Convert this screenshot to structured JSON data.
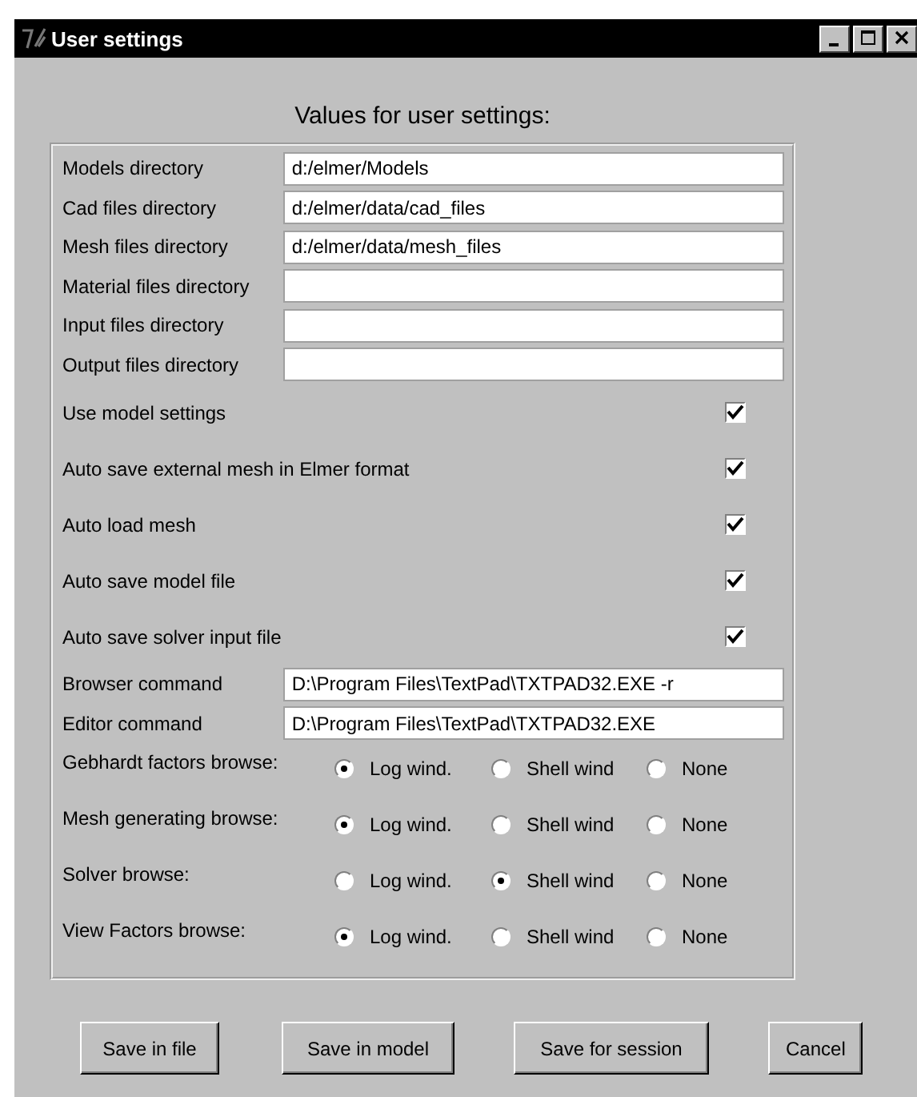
{
  "window": {
    "title": "User settings"
  },
  "heading": "Values for user settings:",
  "fields": [
    {
      "label": "Models directory",
      "value": "d:/elmer/Models"
    },
    {
      "label": "Cad files directory",
      "value": "d:/elmer/data/cad_files"
    },
    {
      "label": "Mesh files directory",
      "value": "d:/elmer/data/mesh_files"
    },
    {
      "label": "Material files directory"
    },
    {
      "label": "Input files directory"
    },
    {
      "label": "Output files directory"
    }
  ],
  "checkboxes": [
    {
      "label": "Use model settings",
      "checked": true
    },
    {
      "label": "Auto save external mesh in Elmer format",
      "checked": true
    },
    {
      "label": "Auto load mesh",
      "checked": true
    },
    {
      "label": "Auto save model file",
      "checked": true
    },
    {
      "label": "Auto save solver input file",
      "checked": true
    }
  ],
  "commands": [
    {
      "label": "Browser command",
      "value": "D:\\Program Files\\TextPad\\TXTPAD32.EXE -r"
    },
    {
      "label": "Editor command",
      "value": "D:\\Program Files\\TextPad\\TXTPAD32.EXE"
    }
  ],
  "radio_groups": [
    {
      "label": "Gebhardt factors browse:",
      "options": [
        {
          "label": "Log wind.",
          "selected": true
        },
        {
          "label": "Shell wind",
          "selected": false
        },
        {
          "label": "None",
          "selected": false
        }
      ]
    },
    {
      "label": "Mesh generating browse:",
      "options": [
        {
          "label": "Log wind.",
          "selected": true
        },
        {
          "label": "Shell wind",
          "selected": false
        },
        {
          "label": "None",
          "selected": false
        }
      ]
    },
    {
      "label": "Solver browse:",
      "options": [
        {
          "label": "Log wind.",
          "selected": false
        },
        {
          "label": "Shell wind",
          "selected": true
        },
        {
          "label": "None",
          "selected": false
        }
      ]
    },
    {
      "label": "View Factors browse:",
      "options": [
        {
          "label": "Log wind.",
          "selected": true
        },
        {
          "label": "Shell wind",
          "selected": false
        },
        {
          "label": "None",
          "selected": false
        }
      ]
    }
  ],
  "buttons": [
    "Save in file",
    "Save in model",
    "Save for session",
    "Cancel"
  ]
}
